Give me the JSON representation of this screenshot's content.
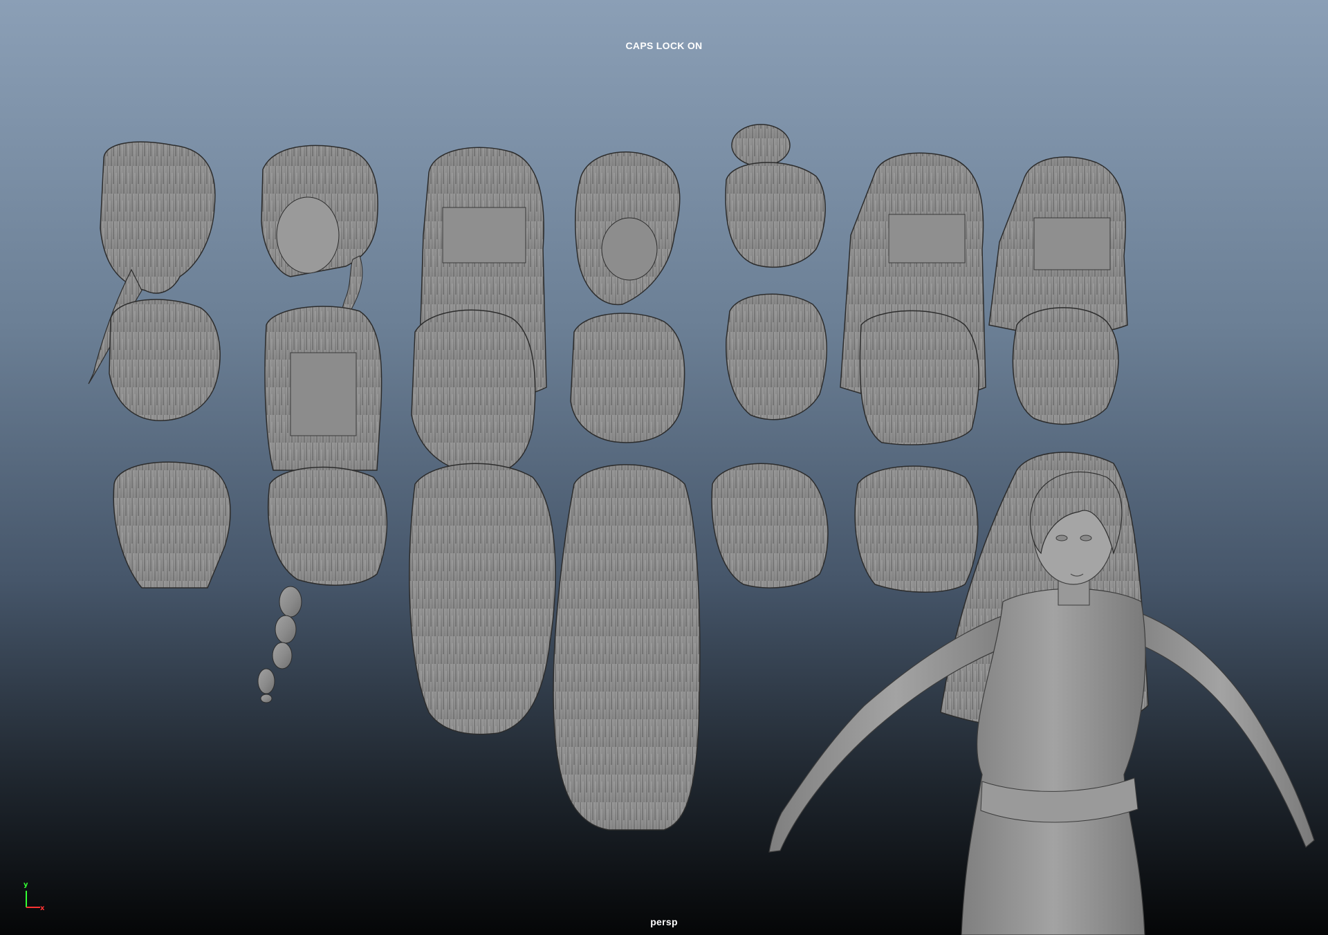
{
  "viewport": {
    "hud_message": "CAPS LOCK ON",
    "camera_name": "persp",
    "background_top": "#8b9fb6",
    "background_bottom": "#050607",
    "mesh_color": "#8c8c8c"
  },
  "axis_gizmo": {
    "y_label": "y",
    "x_label": "x",
    "y_color": "#33ff33",
    "x_color": "#ff3333"
  }
}
